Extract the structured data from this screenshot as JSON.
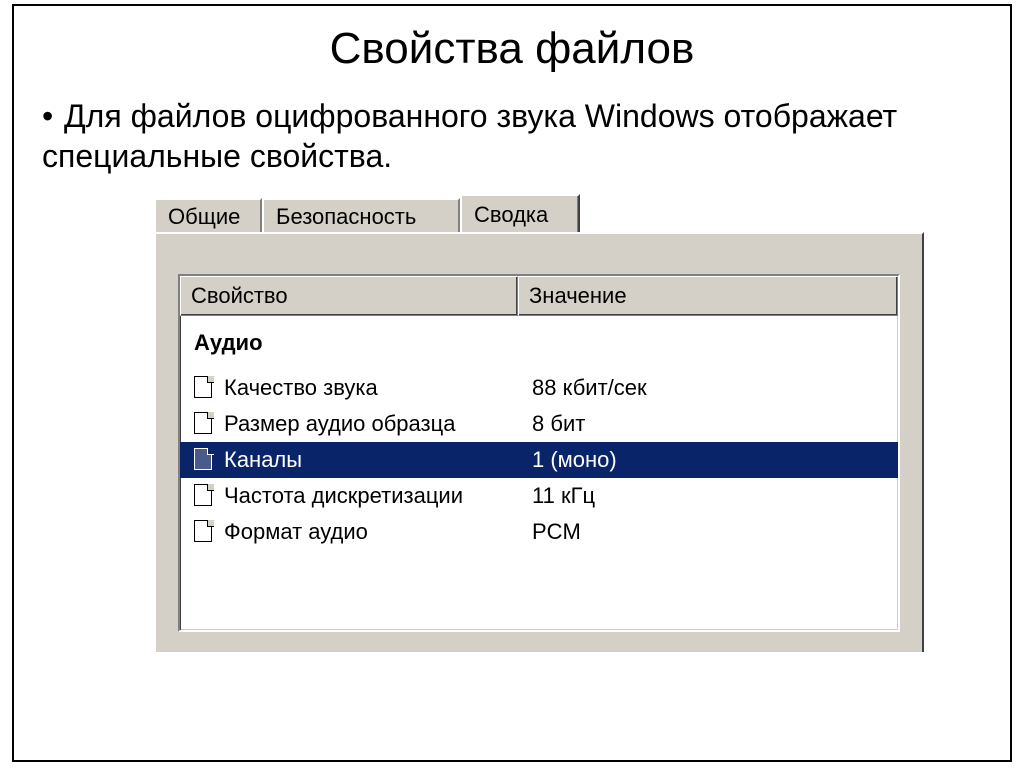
{
  "slide": {
    "title": "Свойства файлов",
    "bullet": "Для файлов оцифрованного звука Windows отображает специальные свойства."
  },
  "dialog": {
    "tabs": {
      "general": "Общие",
      "security": "Безопасность",
      "summary": "Сводка"
    },
    "columns": {
      "property": "Свойство",
      "value": "Значение"
    },
    "group": "Аудио",
    "rows": [
      {
        "prop": "Качество звука",
        "val": "88 кбит/сек",
        "selected": false
      },
      {
        "prop": "Размер аудио образца",
        "val": "8 бит",
        "selected": false
      },
      {
        "prop": "Каналы",
        "val": "1 (моно)",
        "selected": true
      },
      {
        "prop": "Частота дискретизации",
        "val": "11 кГц",
        "selected": false
      },
      {
        "prop": "Формат аудио",
        "val": "PCM",
        "selected": false
      }
    ]
  }
}
